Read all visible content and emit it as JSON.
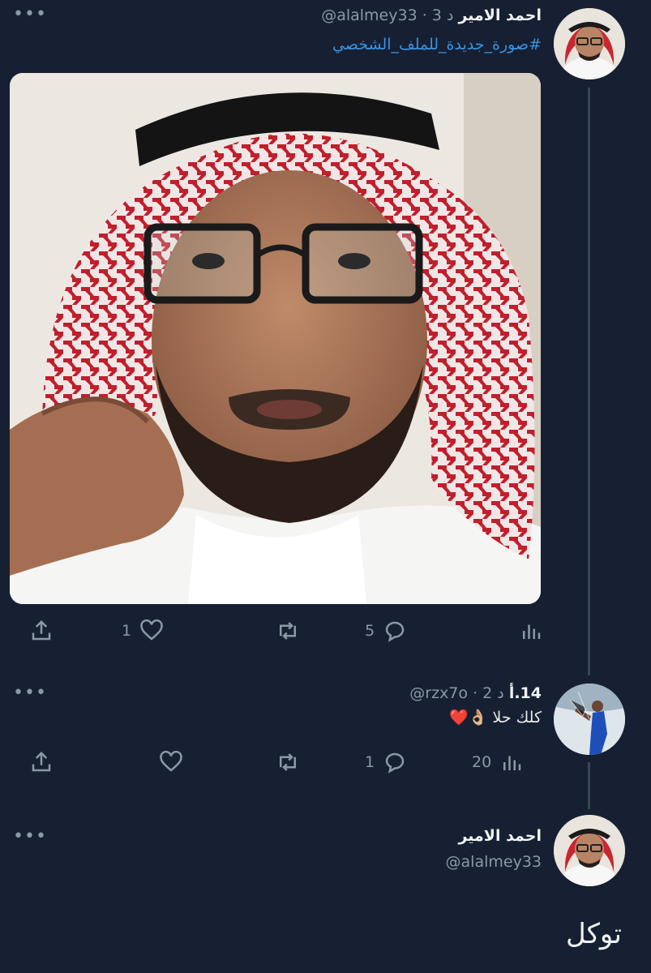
{
  "tweet": {
    "author_name": "احمد الامير",
    "handle": "@alalmey33",
    "time": "· 3 د",
    "hashtag": "#صورة_جديدة_للملف_الشخصي",
    "likes": "1",
    "retweets": "",
    "replies": "5",
    "views": ""
  },
  "reply": {
    "author_name": "14.أ",
    "handle": "@rzx7o",
    "time": "· 2 د",
    "text": "كلك حلا 👌🏼❤️",
    "likes": "",
    "retweets": "",
    "replies": "1",
    "views": "20"
  },
  "composer": {
    "author_name": "احمد الامير",
    "handle": "@alalmey33",
    "text": "توكل"
  },
  "colors": {
    "background": "#162032",
    "link": "#3a92e0",
    "muted": "#8b98a5",
    "thread_line": "#3a4557"
  },
  "icons": {
    "more": "more-horizontal-icon",
    "share": "share-icon",
    "like": "heart-icon",
    "retweet": "retweet-icon",
    "reply": "reply-bubble-icon",
    "views": "analytics-bars-icon"
  }
}
